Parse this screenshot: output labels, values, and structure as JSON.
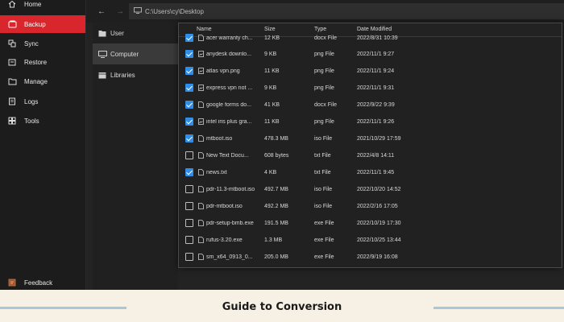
{
  "sidebar": {
    "items": [
      {
        "label": "Home",
        "icon": "home-icon"
      },
      {
        "label": "Backup",
        "icon": "backup-icon"
      },
      {
        "label": "Sync",
        "icon": "sync-icon"
      },
      {
        "label": "Restore",
        "icon": "restore-icon"
      },
      {
        "label": "Manage",
        "icon": "manage-icon"
      },
      {
        "label": "Logs",
        "icon": "logs-icon"
      },
      {
        "label": "Tools",
        "icon": "tools-icon"
      }
    ],
    "active_index": 1,
    "feedback_label": "Feedback"
  },
  "pathbar": {
    "back": "←",
    "forward": "→",
    "path": "C:\\Users\\cy\\Desktop"
  },
  "tree": {
    "items": [
      "User",
      "Computer",
      "Libraries"
    ],
    "selected_index": 1
  },
  "file_list": {
    "headers": {
      "name": "Name",
      "size": "Size",
      "type": "Type",
      "date": "Date Modified"
    },
    "rows": [
      {
        "name": "acer warranty ch...",
        "size": "12 KB",
        "type": "docx File",
        "date": "2022/8/31 10:39",
        "checked": true,
        "kind": "doc"
      },
      {
        "name": "anydesk downlo...",
        "size": "9 KB",
        "type": "png File",
        "date": "2022/11/1 9:27",
        "checked": true,
        "kind": "img"
      },
      {
        "name": "atlas vpn.png",
        "size": "11 KB",
        "type": "png File",
        "date": "2022/11/1 9:24",
        "checked": true,
        "kind": "img"
      },
      {
        "name": "express vpn not ...",
        "size": "9 KB",
        "type": "png File",
        "date": "2022/11/1 9:31",
        "checked": true,
        "kind": "img"
      },
      {
        "name": "google forms do...",
        "size": "41 KB",
        "type": "docx File",
        "date": "2022/9/22 9:39",
        "checked": true,
        "kind": "doc"
      },
      {
        "name": "intel iris plus gra...",
        "size": "11 KB",
        "type": "png File",
        "date": "2022/11/1 9:26",
        "checked": true,
        "kind": "img"
      },
      {
        "name": "mtboot.iso",
        "size": "478.3 MB",
        "type": "iso File",
        "date": "2021/10/29 17:59",
        "checked": true,
        "kind": "file"
      },
      {
        "name": "New Text Docu...",
        "size": "608 bytes",
        "type": "txt File",
        "date": "2022/4/8 14:11",
        "checked": false,
        "kind": "file"
      },
      {
        "name": "news.txt",
        "size": "4 KB",
        "type": "txt File",
        "date": "2022/11/1 9:45",
        "checked": true,
        "kind": "file"
      },
      {
        "name": "pdr-11.3-mtboot.iso",
        "size": "492.7 MB",
        "type": "iso File",
        "date": "2022/10/20 14:52",
        "checked": false,
        "kind": "file"
      },
      {
        "name": "pdr-mtboot.iso",
        "size": "492.2 MB",
        "type": "iso File",
        "date": "2022/2/16 17:05",
        "checked": false,
        "kind": "file"
      },
      {
        "name": "pdr-setup-bmb.exe",
        "size": "191.5 MB",
        "type": "exe File",
        "date": "2022/10/19 17:30",
        "checked": false,
        "kind": "file"
      },
      {
        "name": "rufus-3.20.exe",
        "size": "1.3 MB",
        "type": "exe File",
        "date": "2022/10/25 13:44",
        "checked": false,
        "kind": "file"
      },
      {
        "name": "sm_x64_0913_0...",
        "size": "205.0 MB",
        "type": "exe File",
        "date": "2022/9/19 16:08",
        "checked": false,
        "kind": "file"
      }
    ]
  },
  "caption": {
    "text": "Guide to Conversion"
  },
  "colors": {
    "accent": "#d9262c",
    "checkbox": "#2f8ee8",
    "caption_line": "#a9c7d9"
  }
}
